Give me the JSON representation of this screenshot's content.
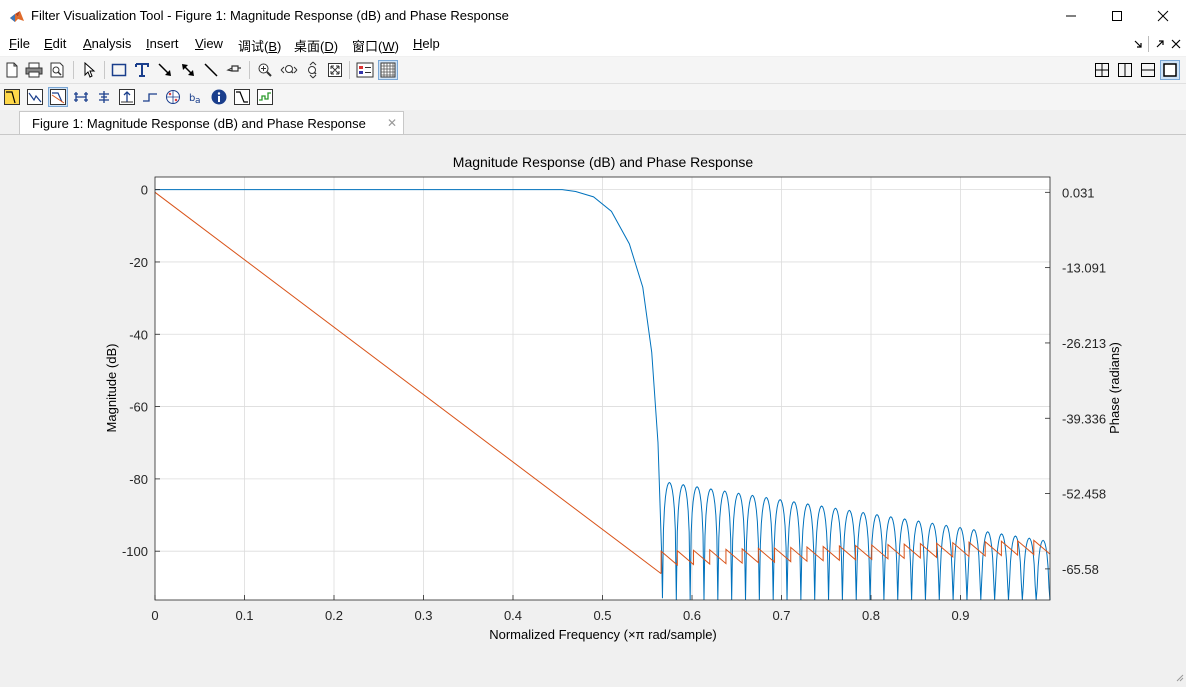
{
  "window": {
    "title": "Filter Visualization Tool - Figure 1: Magnitude Response (dB) and Phase Response",
    "minimize": "─",
    "maximize": "☐",
    "close": "✕"
  },
  "menu": {
    "items": [
      {
        "pre": "",
        "ul": "F",
        "post": "ile"
      },
      {
        "pre": "",
        "ul": "E",
        "post": "dit"
      },
      {
        "pre": "",
        "ul": "A",
        "post": "nalysis"
      },
      {
        "pre": "",
        "ul": "I",
        "post": "nsert"
      },
      {
        "pre": "",
        "ul": "V",
        "post": "iew"
      },
      {
        "pre": "调试(",
        "ul": "B",
        "post": ")"
      },
      {
        "pre": "桌面(",
        "ul": "D",
        "post": ")"
      },
      {
        "pre": "窗口(",
        "ul": "W",
        "post": ")"
      },
      {
        "pre": "",
        "ul": "H",
        "post": "elp"
      }
    ],
    "right_icons": [
      "dock-arrow-icon",
      "undock-arrow-icon",
      "close-figure-icon"
    ]
  },
  "tab": {
    "label": "Figure 1: Magnitude Response (dB) and Phase Response",
    "close": "✕"
  },
  "colors": {
    "magnitude": "#0072BD",
    "phase": "#D95319",
    "grid": "#dcdcdc",
    "axes_bg": "#ffffff"
  },
  "chart_data": {
    "type": "line",
    "title": "Magnitude Response (dB) and Phase Response",
    "xlabel": "Normalized Frequency (×π rad/sample)",
    "ylabel": "Magnitude (dB)",
    "y2label": "Phase (radians)",
    "xlim": [
      0,
      1
    ],
    "ylim": [
      -113.5,
      3.5
    ],
    "y2lim": [
      -71.0,
      2.7
    ],
    "xticks": [
      "0",
      "0.1",
      "0.2",
      "0.3",
      "0.4",
      "0.5",
      "0.6",
      "0.7",
      "0.8",
      "0.9"
    ],
    "xtick_values": [
      0,
      0.1,
      0.2,
      0.3,
      0.4,
      0.5,
      0.6,
      0.7,
      0.8,
      0.9
    ],
    "yticks": [
      "0",
      "-20",
      "-40",
      "-60",
      "-80",
      "-100"
    ],
    "ytick_values": [
      0,
      -20,
      -40,
      -60,
      -80,
      -100
    ],
    "y2ticks": [
      "0.031",
      "-13.091",
      "-26.213",
      "-39.336",
      "-52.458",
      "-65.58"
    ],
    "y2tick_values": [
      0.031,
      -13.091,
      -26.213,
      -39.336,
      -52.458,
      -65.58
    ],
    "grid": true,
    "series": [
      {
        "name": "Magnitude (dB)",
        "axis": "left",
        "passband": {
          "x_end": 0.455,
          "value": 0
        },
        "transition": [
          [
            0.455,
            0
          ],
          [
            0.47,
            -0.5
          ],
          [
            0.49,
            -2
          ],
          [
            0.51,
            -6
          ],
          [
            0.53,
            -15
          ],
          [
            0.545,
            -27
          ],
          [
            0.555,
            -45
          ],
          [
            0.562,
            -70
          ],
          [
            0.566,
            -100
          ],
          [
            0.567,
            -113
          ]
        ],
        "stopband": {
          "x_start": 0.567,
          "x_end": 1.0,
          "lobes": 28,
          "peak_start": -81,
          "peak_end": -97,
          "floor": -113.5
        }
      },
      {
        "name": "Phase (radians)",
        "axis": "right",
        "segments": [
          {
            "x": [
              0,
              0.5655
            ],
            "y": [
              0.031,
              -66.4
            ]
          },
          {
            "x": [
              0.5655,
              1.0
            ],
            "y_start_after_jump": -62.5,
            "y_end": -60.6,
            "jumps": 24,
            "sawtooth_height": 2.4
          }
        ]
      }
    ]
  }
}
